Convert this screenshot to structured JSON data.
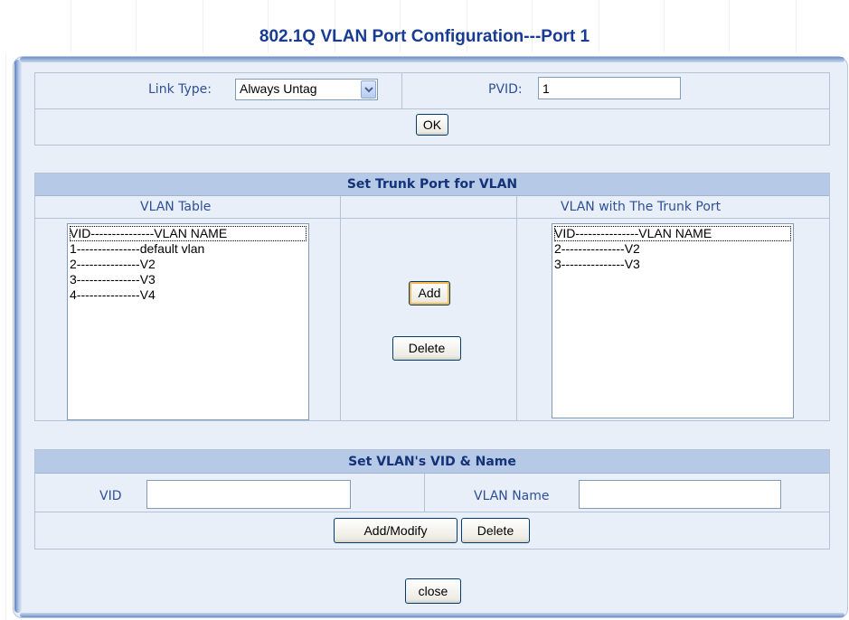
{
  "title": "802.1Q VLAN Port Configuration---Port 1",
  "link_config": {
    "link_type_label": "Link Type:",
    "link_type_value": "Always Untag",
    "pvid_label": "PVID:",
    "pvid_value": "1",
    "ok_label": "OK"
  },
  "trunk": {
    "header": "Set Trunk Port for VLAN",
    "vlan_table_header": "VLAN Table",
    "trunk_table_header": "VLAN with The Trunk Port",
    "vlan_table_items": [
      "VID---------------VLAN NAME",
      "1---------------default vlan",
      "2---------------V2",
      "3---------------V3",
      "4---------------V4"
    ],
    "trunk_table_items": [
      "VID---------------VLAN NAME",
      "2---------------V2",
      "3---------------V3"
    ],
    "add_label": "Add",
    "delete_label": "Delete"
  },
  "vid_name": {
    "header": "Set VLAN's VID & Name",
    "vid_label": "VID",
    "vid_value": "",
    "name_label": "VLAN Name",
    "name_value": "",
    "add_modify_label": "Add/Modify",
    "delete_label": "Delete"
  },
  "close_label": "close",
  "colors": {
    "title": "#183c93",
    "panel_bg": "#e9eff8",
    "header_bg": "#b6c9e6",
    "label": "#2e4f98"
  }
}
